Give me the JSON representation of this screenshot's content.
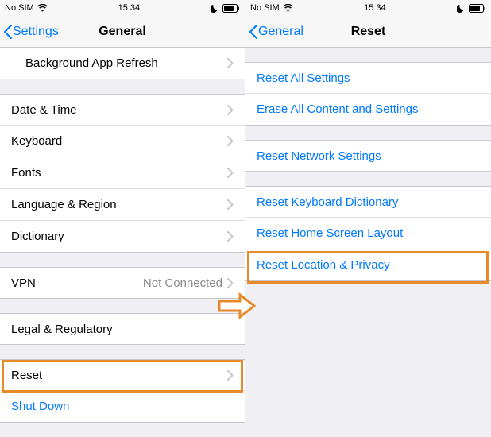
{
  "statusbar": {
    "carrier": "No SIM",
    "time": "15:34"
  },
  "left": {
    "back_label": "Settings",
    "title": "General",
    "rows": {
      "bg_refresh": "Background App Refresh",
      "date_time": "Date & Time",
      "keyboard": "Keyboard",
      "fonts": "Fonts",
      "lang_region": "Language & Region",
      "dictionary": "Dictionary",
      "vpn": "VPN",
      "vpn_detail": "Not Connected",
      "legal": "Legal & Regulatory",
      "reset": "Reset",
      "shut_down": "Shut Down"
    }
  },
  "right": {
    "back_label": "General",
    "title": "Reset",
    "rows": {
      "reset_all": "Reset All Settings",
      "erase_all": "Erase All Content and Settings",
      "reset_network": "Reset Network Settings",
      "reset_keyboard": "Reset Keyboard Dictionary",
      "reset_home": "Reset Home Screen Layout",
      "reset_location": "Reset Location & Privacy"
    }
  },
  "annotation": {
    "highlight_color": "#e88a2a"
  }
}
